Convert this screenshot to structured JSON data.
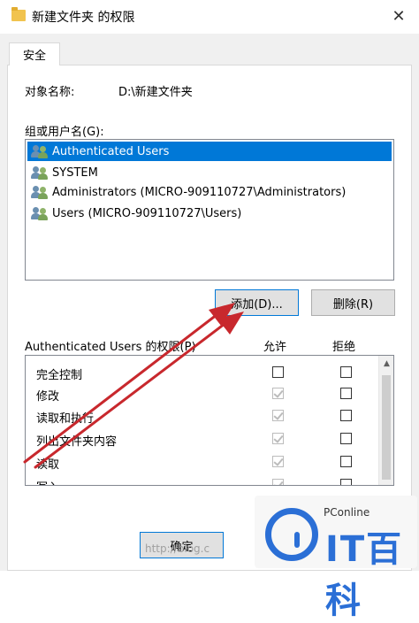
{
  "window": {
    "title": "新建文件夹 的权限",
    "close_glyph": "✕"
  },
  "tabs": [
    {
      "label": "安全"
    }
  ],
  "object": {
    "label": "对象名称:",
    "value": "D:\\新建文件夹"
  },
  "groups": {
    "label": "组或用户名(G):",
    "items": [
      {
        "label": "Authenticated Users",
        "selected": true
      },
      {
        "label": "SYSTEM",
        "selected": false
      },
      {
        "label": "Administrators (MICRO-909110727\\Administrators)",
        "selected": false
      },
      {
        "label": "Users (MICRO-909110727\\Users)",
        "selected": false
      }
    ]
  },
  "buttons": {
    "add": "添加(D)...",
    "remove": "删除(R)",
    "ok": "确定"
  },
  "permissions": {
    "label": "Authenticated Users 的权限(P)",
    "col_allow": "允许",
    "col_deny": "拒绝",
    "rows": [
      {
        "name": "完全控制",
        "allow": false,
        "deny": false
      },
      {
        "name": "修改",
        "allow": true,
        "deny": false
      },
      {
        "name": "读取和执行",
        "allow": true,
        "deny": false
      },
      {
        "name": "列出文件夹内容",
        "allow": true,
        "deny": false
      },
      {
        "name": "读取",
        "allow": true,
        "deny": false
      },
      {
        "name": "写入",
        "allow": true,
        "deny": false
      }
    ]
  },
  "overlay": {
    "watermark": "http://blog.c",
    "logo_brand": "PConline",
    "logo_text": "IT百科",
    "arrow_color": "#c8282d"
  },
  "icons": {
    "folder": "folder-icon",
    "users": "users-group-icon",
    "close": "close-icon"
  }
}
